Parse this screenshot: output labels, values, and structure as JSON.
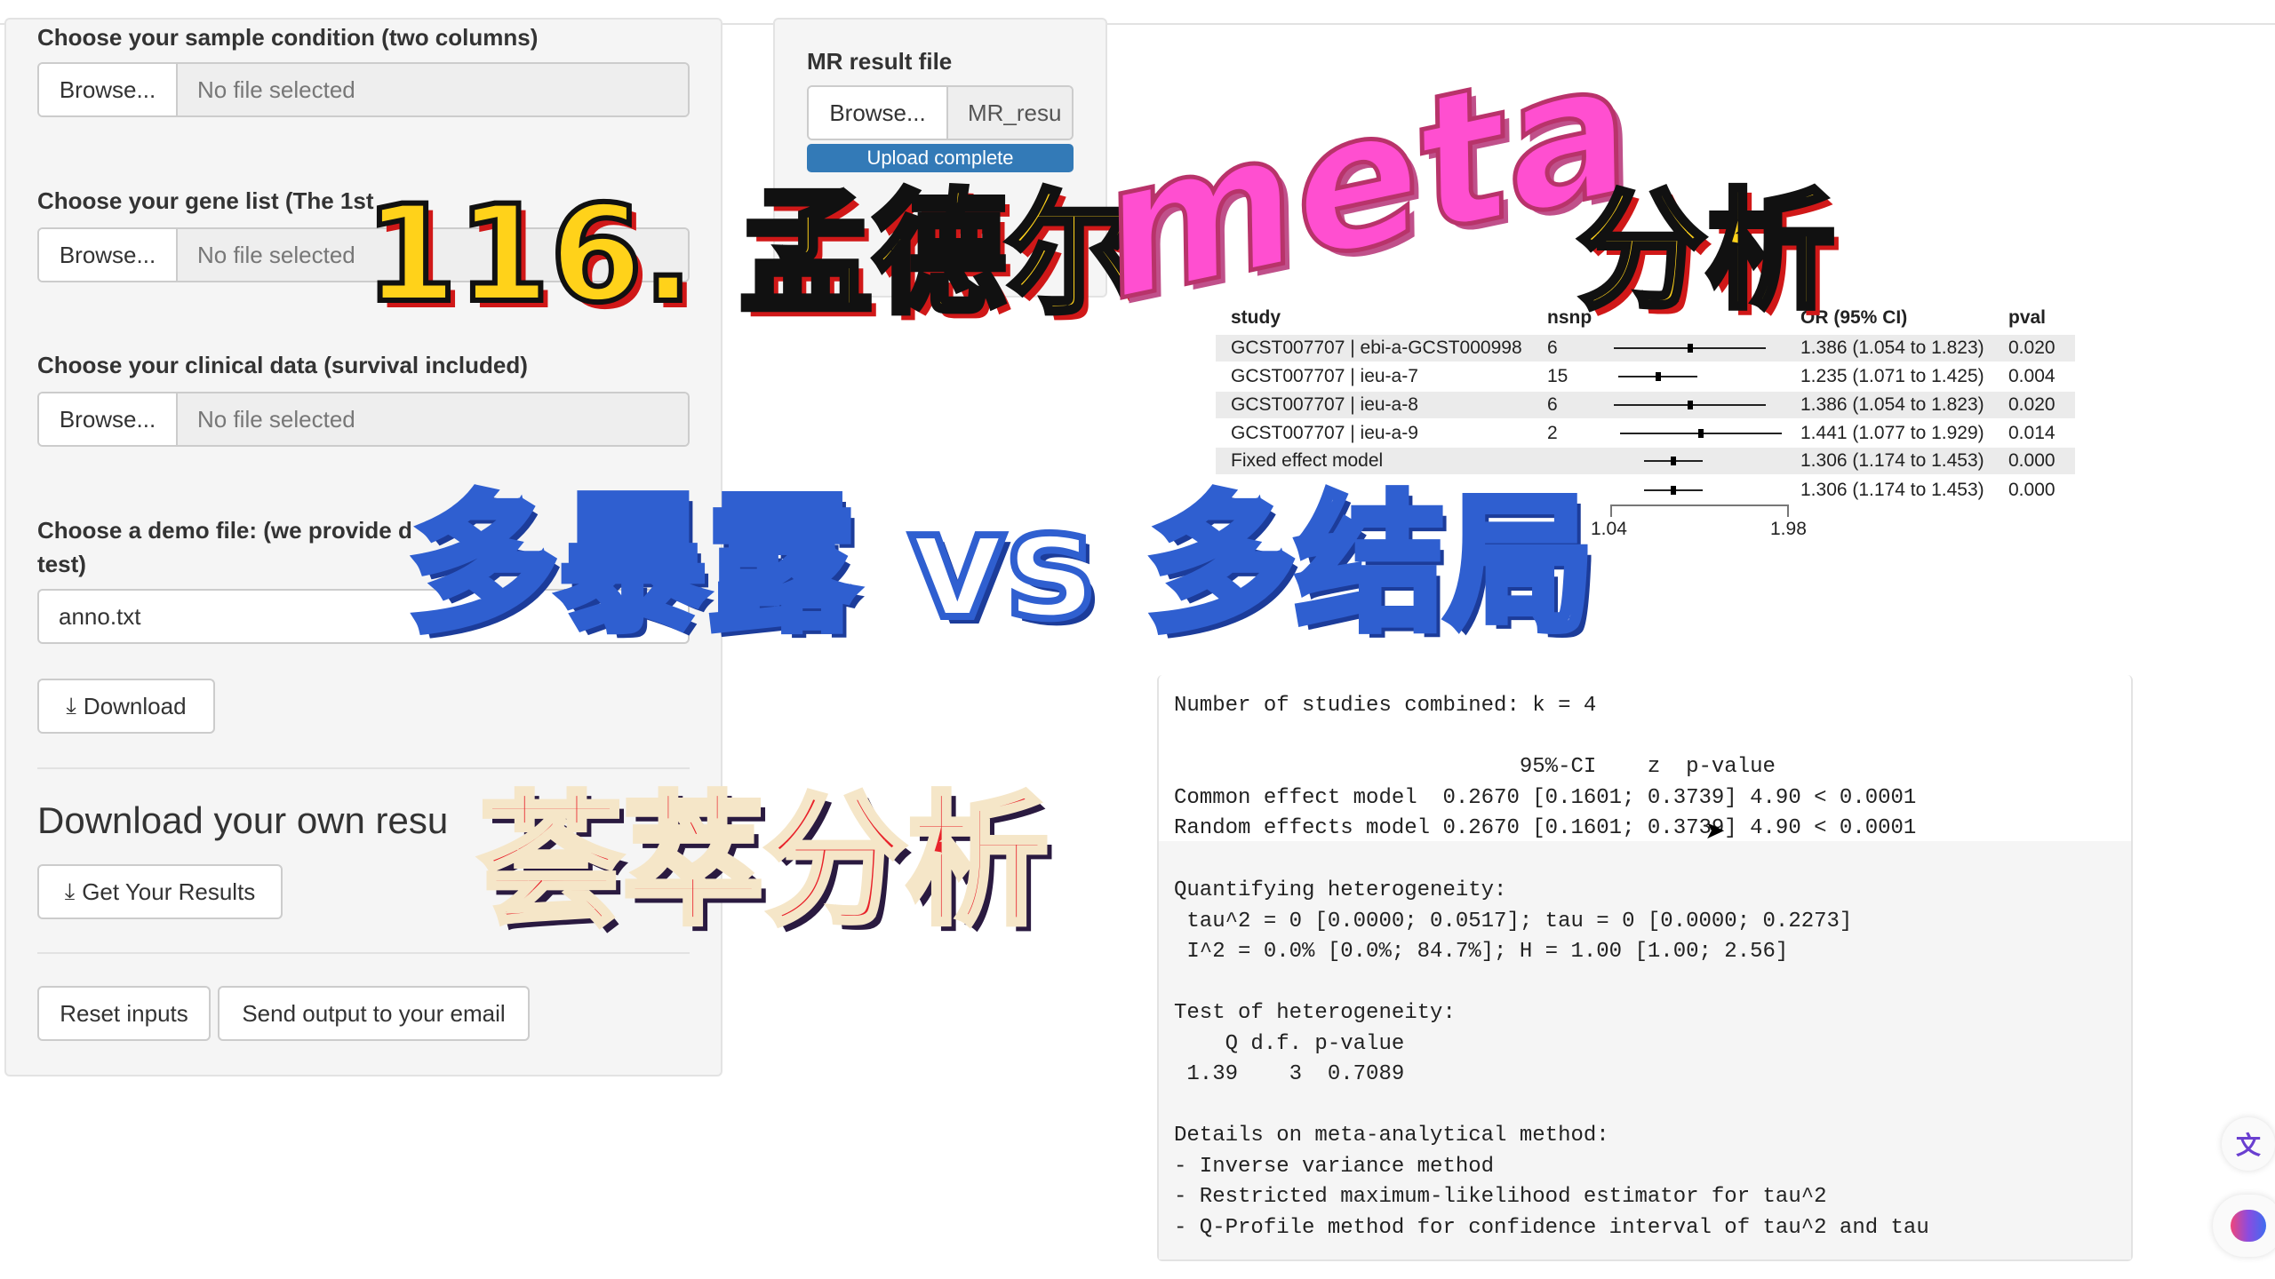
{
  "left_panel": {
    "sample_label": "Choose your sample condition (two columns)",
    "gene_label": "Choose your gene list (The 1st",
    "clinical_label": "Choose your clinical data (survival included)",
    "demo_label_1": "Choose a demo file: (we provide d",
    "demo_label_2": "test)",
    "browse": "Browse...",
    "no_file": "No file selected",
    "demo_value": "anno.txt",
    "download": "Download",
    "own_results_heading": "Download your own resu",
    "get_results": "Get Your Results",
    "reset": "Reset inputs",
    "send_email": "Send output to your email"
  },
  "mr_panel": {
    "label": "MR result file",
    "browse": "Browse...",
    "file_value": "MR_resu",
    "upload_status": "Upload complete",
    "progress_percent": 100,
    "accent": "#337ab7"
  },
  "forest": {
    "headers": {
      "study": "study",
      "nsnp": "nsnp",
      "or": "OR (95% CI)",
      "pval": "pval"
    },
    "rows": [
      {
        "study": "GCST007707 | ebi-a-GCST000998",
        "nsnp": "6",
        "or": 1.386,
        "lo": 1.054,
        "hi": 1.823,
        "or_text": "1.386 (1.054 to 1.823)",
        "pval": "0.020"
      },
      {
        "study": "GCST007707 | ieu-a-7",
        "nsnp": "15",
        "or": 1.235,
        "lo": 1.071,
        "hi": 1.425,
        "or_text": "1.235 (1.071 to 1.425)",
        "pval": "0.004"
      },
      {
        "study": "GCST007707 | ieu-a-8",
        "nsnp": "6",
        "or": 1.386,
        "lo": 1.054,
        "hi": 1.823,
        "or_text": "1.386 (1.054 to 1.823)",
        "pval": "0.020"
      },
      {
        "study": "GCST007707 | ieu-a-9",
        "nsnp": "2",
        "or": 1.441,
        "lo": 1.077,
        "hi": 1.929,
        "or_text": "1.441 (1.077 to 1.929)",
        "pval": "0.014"
      },
      {
        "study": "Fixed effect model",
        "nsnp": "",
        "or": 1.306,
        "lo": 1.174,
        "hi": 1.453,
        "or_text": "1.306 (1.174 to 1.453)",
        "pval": "0.000"
      },
      {
        "study": "",
        "nsnp": "",
        "or": 1.306,
        "lo": 1.174,
        "hi": 1.453,
        "or_text": "1.306 (1.174 to 1.453)",
        "pval": "0.000"
      }
    ],
    "axis_ticks": [
      "1.04",
      "1.98"
    ],
    "axis_range": [
      1.04,
      1.98
    ],
    "scale": "log"
  },
  "output": {
    "lines": [
      "Number of studies combined: k = 4",
      "",
      "                           95%-CI    z  p-value",
      "Common effect model  0.2670 [0.1601; 0.3739] 4.90 < 0.0001",
      "Random effects model 0.2670 [0.1601; 0.3739] 4.90 < 0.0001"
    ],
    "gray_lines": [
      "Quantifying heterogeneity:",
      " tau^2 = 0 [0.0000; 0.0517]; tau = 0 [0.0000; 0.2273]",
      " I^2 = 0.0% [0.0%; 84.7%]; H = 1.00 [1.00; 2.56]",
      "",
      "Test of heterogeneity:",
      "    Q d.f. p-value",
      " 1.39    3  0.7089",
      "",
      "Details on meta-analytical method:",
      "- Inverse variance method",
      "- Restricted maximum-likelihood estimator for tau^2",
      "- Q-Profile method for confidence interval of tau^2 and tau"
    ]
  },
  "overlay": {
    "title_num": "116. 孟德尔",
    "meta": "meta",
    "fenxi": "分析",
    "subtitle": "多暴露 vs 多结局",
    "tag": "荟萃分析"
  },
  "side_icons": [
    "translate-icon",
    "brain-icon"
  ]
}
